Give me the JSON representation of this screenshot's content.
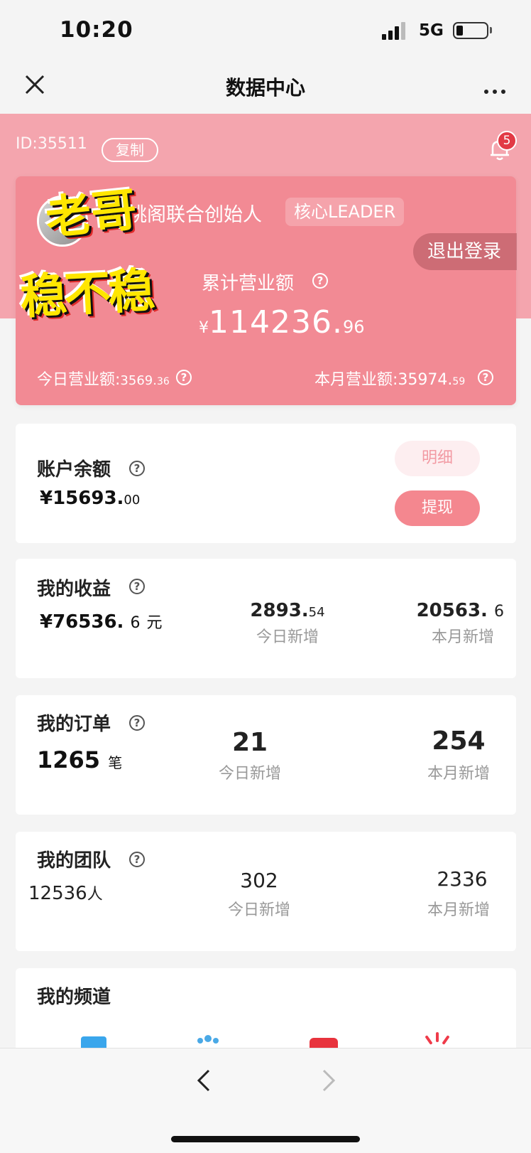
{
  "status": {
    "time": "10:20",
    "network": "5G"
  },
  "nav": {
    "title": "数据中心"
  },
  "header": {
    "user_id": "ID:35511",
    "copy_label": "复制",
    "notification_count": "5",
    "user_title": "桃阁联合创始人",
    "user_tag": "核心LEADER",
    "logout_label": "退出登录",
    "total_label": "累计营业额",
    "total_currency": "¥",
    "total_int": "114236.",
    "total_dec": "96",
    "today_label": "今日营业额:",
    "today_int": "3569.",
    "today_dec": "36",
    "month_label": "本月营业额:",
    "month_int": "35974.",
    "month_dec": "59",
    "sticker_line1": "老哥",
    "sticker_line2": "稳不稳"
  },
  "balance": {
    "title": "账户余额",
    "value_int": "¥15693.",
    "value_dec": "00",
    "detail_label": "明细",
    "withdraw_label": "提现"
  },
  "earnings": {
    "title": "我的收益",
    "value": "¥76536.",
    "value_dec": "6",
    "unit": "元",
    "today_int": "2893.",
    "today_dec": "54",
    "today_label": "今日新增",
    "month_int": "20563.",
    "month_dec": "6",
    "month_label": "本月新增"
  },
  "orders": {
    "title": "我的订单",
    "value": "1265",
    "unit": "笔",
    "today": "21",
    "today_label": "今日新增",
    "month": "254",
    "month_label": "本月新增"
  },
  "team": {
    "title": "我的团队",
    "value": "12536",
    "unit": "人",
    "today": "302",
    "today_label": "今日新增",
    "month": "2336",
    "month_label": "本月新增"
  },
  "channel": {
    "title": "我的频道"
  },
  "colors": {
    "pink_band": "#f4a5ae",
    "card_pink": "#f28a94",
    "button_pink": "#f4878f",
    "badge_red": "#e23a45"
  }
}
